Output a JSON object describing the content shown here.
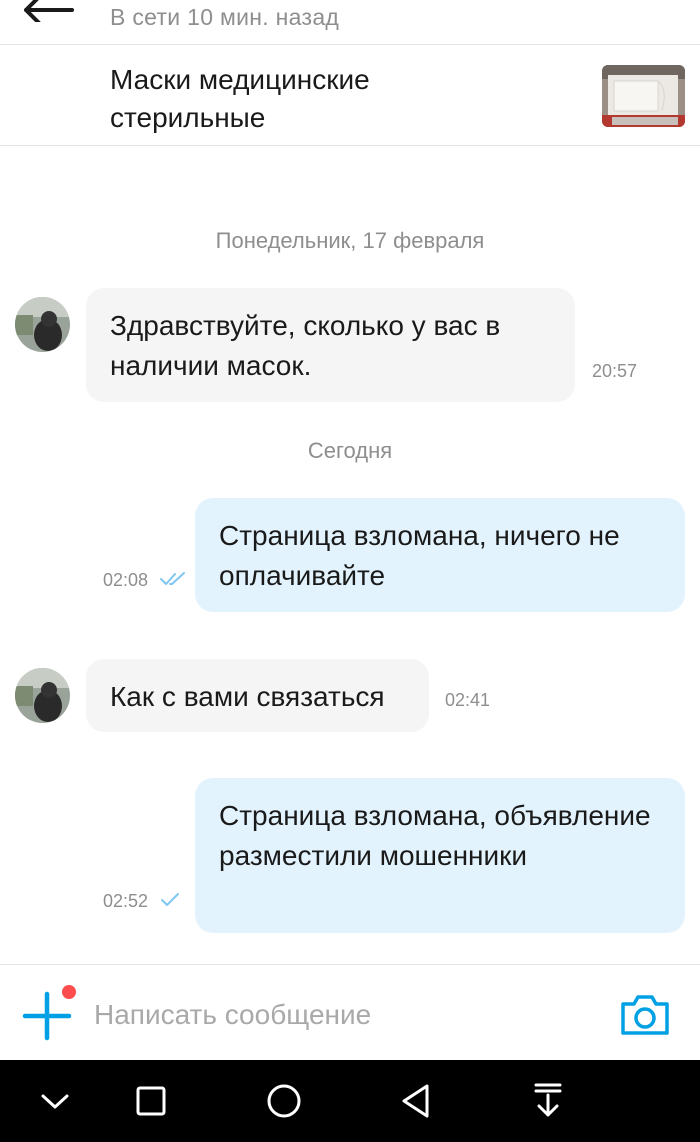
{
  "header": {
    "status": "В сети 10 мин. назад",
    "listing_title": "Маски медицинские стерильные"
  },
  "messages": [
    {
      "type": "date",
      "text": "Понедельник, 17 февраля"
    },
    {
      "type": "incoming",
      "text": "Здравствуйте, сколько у вас в наличии масок.",
      "time": "20:57"
    },
    {
      "type": "date",
      "text": "Сегодня"
    },
    {
      "type": "outgoing",
      "text": "Страница взломана, ничего не оплачивайте",
      "time": "02:08",
      "status": "read"
    },
    {
      "type": "incoming",
      "text": "Как с вами связаться",
      "time": "02:41"
    },
    {
      "type": "outgoing",
      "text": "Страница взломана, объявление разместили мошенники",
      "time": "02:52",
      "status": "sent"
    }
  ],
  "composer": {
    "placeholder": "Написать сообщение",
    "attach_icon": "plus-icon",
    "camera_icon": "camera-icon"
  },
  "colors": {
    "accent": "#00a0e4",
    "incoming_bubble": "#f5f5f5",
    "outgoing_bubble": "#e3f3fd",
    "notification_dot": "#ff4d4d"
  }
}
